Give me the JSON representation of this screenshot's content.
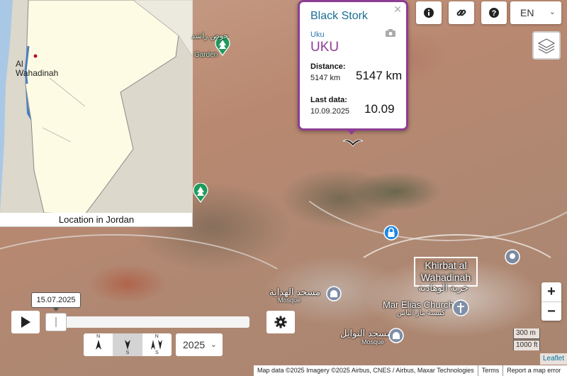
{
  "inset": {
    "caption": "Location in Jordan",
    "town_label": "Al Wahadinah"
  },
  "controls": {
    "language": "EN",
    "zoom_in": "+",
    "zoom_out": "−",
    "year": "2025",
    "north_letter": "N",
    "south_letter": "S"
  },
  "popup": {
    "species": "Black Stork",
    "name_small": "Uku",
    "name_large": "UKU",
    "distance_label": "Distance:",
    "distance_small": "5147 km",
    "distance_large": "5147 km",
    "last_data_label": "Last data:",
    "last_data_date": "10.09.2025",
    "last_data_short": "10.09"
  },
  "map_labels": {
    "garden_ar": "حوض راشد",
    "garden": "Garden",
    "town": "Khirbat al Wahadinah",
    "town_ar": "خربة الوهادنة",
    "mosque1_ar": "مسجد الهداية",
    "mosque1_type": "Mosque",
    "mosque2_ar": "مسجد النوايل",
    "mosque2_type": "Mosque",
    "church": "Mar Elias Church",
    "church_ar": "كنيسة مار الياس"
  },
  "scale": {
    "metric": "300 m",
    "imperial": "1000 ft"
  },
  "timeline": {
    "date": "15.07.2025"
  },
  "attribution": {
    "leaflet": "Leaflet",
    "text": "Map data ©2025 Imagery ©2025 Airbus, CNES / Airbus, Maxar Technologies",
    "terms": "Terms",
    "report": "Report a map error"
  },
  "colors": {
    "popup_accent": "#8e3d94",
    "species_blue": "#1a6d94",
    "park_green": "#1f9a5c",
    "lock_blue": "#1e88e5"
  },
  "icons": [
    "info-icon",
    "link-icon",
    "help-icon",
    "layers-icon",
    "camera-icon",
    "close-icon",
    "bird-marker-icon",
    "park-pin-icon",
    "lock-pin-icon",
    "location-pin-icon",
    "mosque-icon",
    "church-icon",
    "play-icon",
    "gear-icon",
    "north-arrow-icon",
    "south-arrow-icon",
    "both-arrows-icon",
    "chevron-down-icon"
  ]
}
